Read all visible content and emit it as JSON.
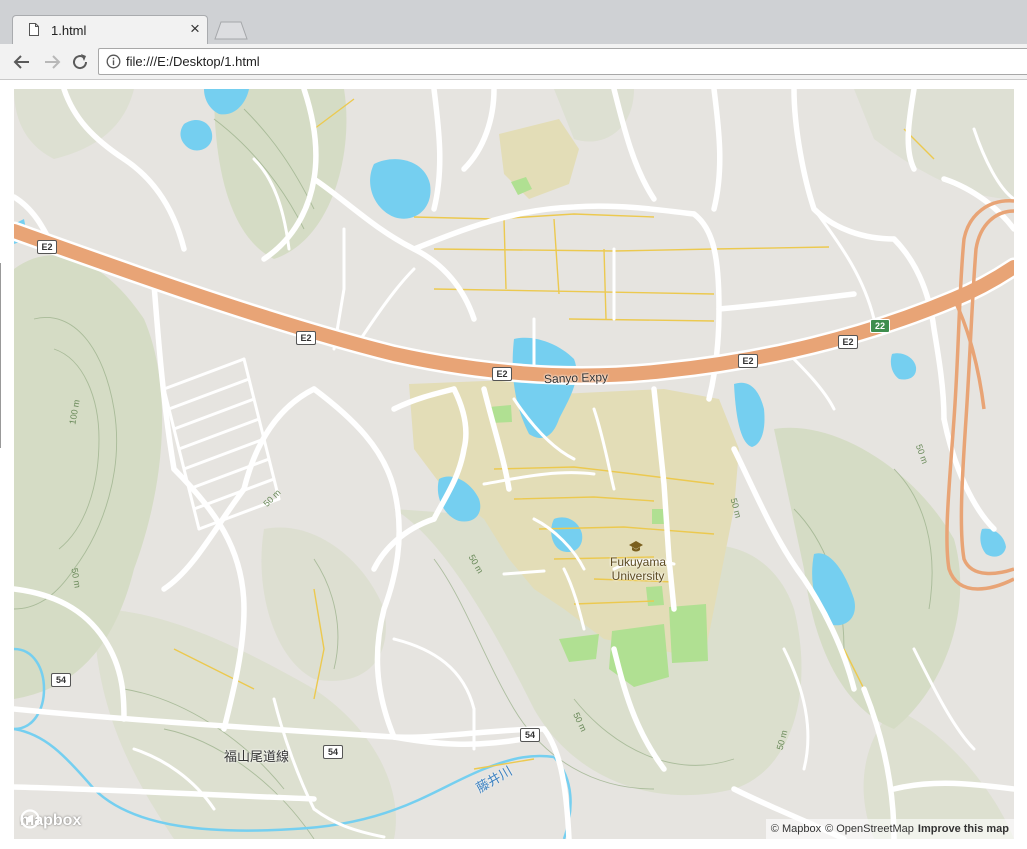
{
  "browser": {
    "tab_title": "1.html",
    "close_glyph": "×",
    "url": "file:///E:/Desktop/1.html",
    "icons": [
      "document-icon",
      "close-icon",
      "back-arrow-icon",
      "forward-arrow-icon",
      "reload-icon",
      "info-icon"
    ]
  },
  "map": {
    "labels": {
      "highway": "Sanyo Expy",
      "university_line1": "Fukuyama",
      "university_line2": "University",
      "road_jp": "福山尾道線",
      "river_jp": "藤井川"
    },
    "shields": {
      "expressway": "E2",
      "national_22": "22",
      "route_54": "54"
    },
    "contours": {
      "m100": "100 m",
      "m50": "50 m"
    },
    "colors": {
      "land": "#e6e4e0",
      "road": "#ffffff",
      "expressway": "#e8a476",
      "water": "#75cff0",
      "campus": "#e3ddb7",
      "park": "#b0e092",
      "hills": "#d3dbc0",
      "minor_road": "#ecc94f"
    },
    "logo_text": "mapbox",
    "attribution": {
      "mapbox": "© Mapbox",
      "osm": "© OpenStreetMap",
      "improve": "Improve this map"
    }
  }
}
